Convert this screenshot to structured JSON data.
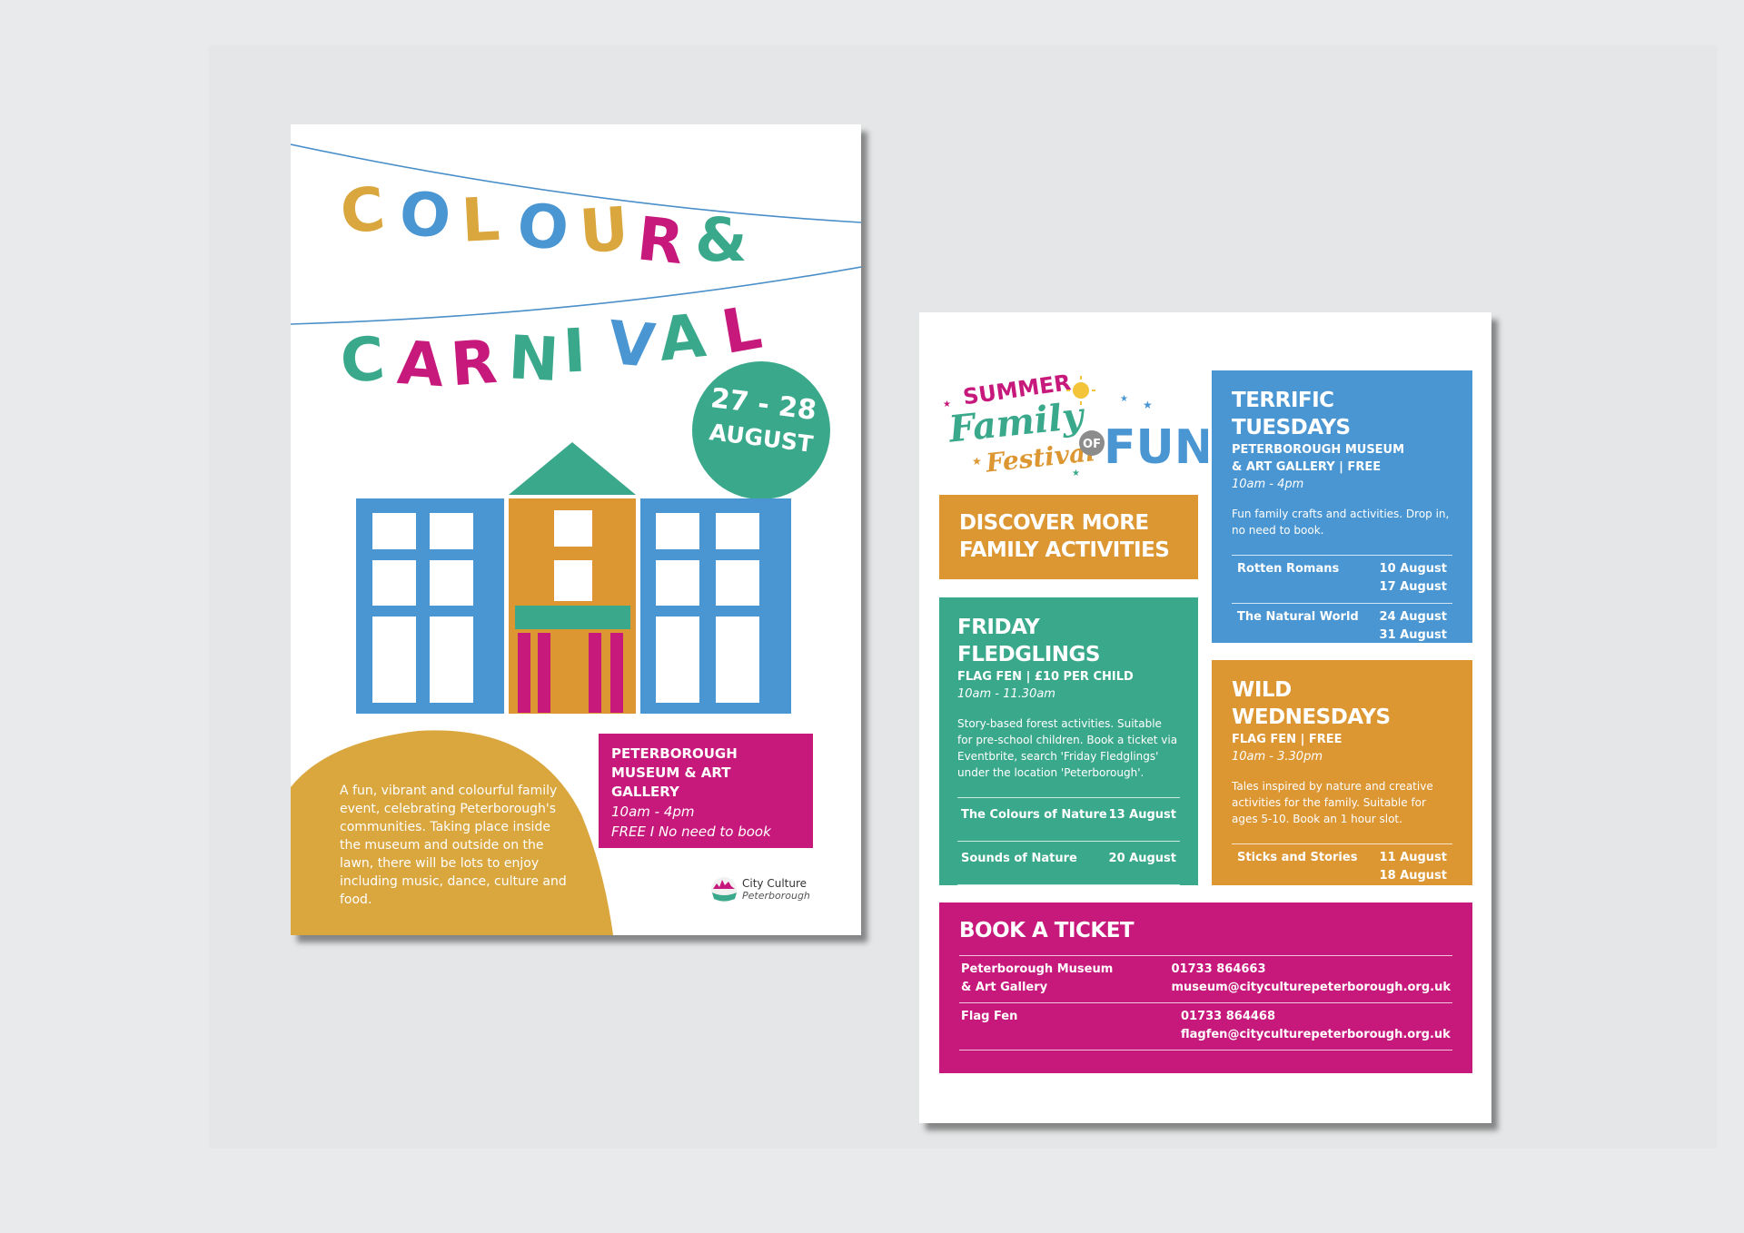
{
  "colors": {
    "teal": "#3aa88b",
    "blue": "#4a96d2",
    "orange": "#dc9632",
    "magenta": "#c7187c",
    "mustard": "#daa63e"
  },
  "left_poster": {
    "title_line1": "COLOUR &",
    "title_line2": "CARNIVAL",
    "date_badge": {
      "line1": "27 - 28",
      "line2": "AUGUST"
    },
    "description": "A fun, vibrant and colourful family event, celebrating Peterborough's communities. Taking place inside the museum and outside on the lawn, there will be lots to enjoy including music, dance, culture and food.",
    "venue": {
      "name": "PETERBOROUGH MUSEUM & ART GALLERY",
      "time": "10am - 4pm",
      "price": "FREE I No need to book"
    },
    "logo": {
      "title": "City Culture",
      "subtitle": "Peterborough"
    }
  },
  "right_flyer": {
    "festival_logo": {
      "summer": "SUMMER",
      "family": "Family",
      "festival": "Festival",
      "of": "OF",
      "fun": "FUN"
    },
    "discover": "DISCOVER MORE FAMILY ACTIVITIES",
    "friday": {
      "title": "FRIDAY FLEDGLINGS",
      "subtitle": "FLAG FEN | £10 PER CHILD",
      "time": "10am - 11.30am",
      "description": "Story-based forest activities. Suitable for pre-school children. Book a ticket via Eventbrite, search 'Friday Fledglings' under the location 'Peterborough'.",
      "sessions": [
        {
          "name": "The Colours of Nature",
          "dates": "13 August"
        },
        {
          "name": "Sounds of Nature",
          "dates": "20 August"
        }
      ]
    },
    "tuesday": {
      "title": "TERRIFIC TUESDAYS",
      "subtitle": "PETERBOROUGH MUSEUM & ART GALLERY | FREE",
      "time": "10am - 4pm",
      "description": "Fun family crafts and activities. Drop in, no need to book.",
      "sessions": [
        {
          "name": "Rotten Romans",
          "dates": "10 August\n17 August"
        },
        {
          "name": "The Natural World",
          "dates": "24 August\n31 August"
        }
      ]
    },
    "wednesday": {
      "title": "WILD WEDNESDAYS",
      "subtitle": "FLAG FEN | FREE",
      "time": "10am - 3.30pm",
      "description": "Tales inspired by nature and creative activities for the family. Suitable for ages 5-10. Book an 1 hour slot.",
      "sessions": [
        {
          "name": "Sticks and Stories",
          "dates": "11 August\n18 August"
        }
      ]
    },
    "book": {
      "title": "BOOK A TICKET",
      "rows": [
        {
          "venue": "Peterborough Museum\n& Art Gallery",
          "contact": "01733 864663\nmuseum@cityculturepeterborough.org.uk"
        },
        {
          "venue": "Flag Fen",
          "contact": "01733 864468\nflagfen@cityculturepeterborough.org.uk"
        }
      ]
    }
  }
}
